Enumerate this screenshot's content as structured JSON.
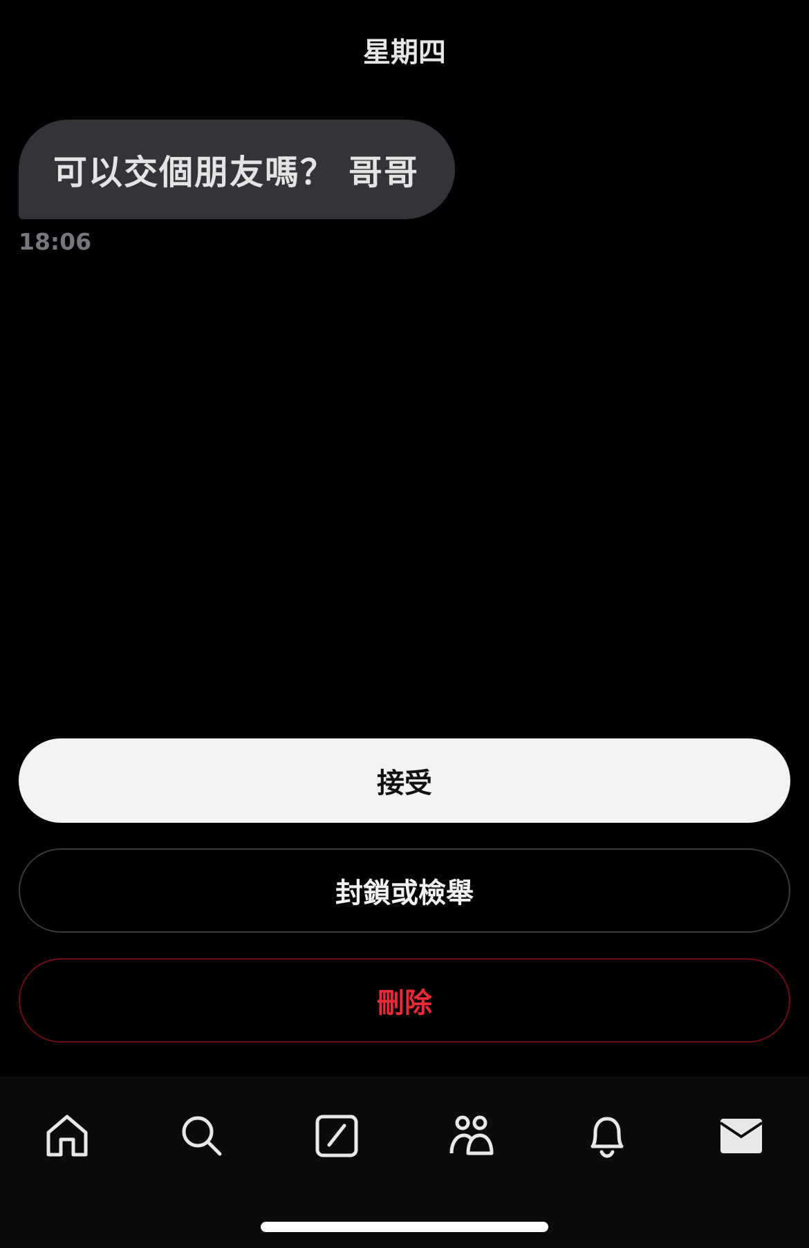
{
  "header": {
    "day_label": "星期四"
  },
  "message": {
    "text": "可以交個朋友嗎？ 哥哥",
    "time": "18:06"
  },
  "actions": {
    "accept_label": "接受",
    "block_or_report_label": "封鎖或檢舉",
    "delete_label": "刪除"
  },
  "colors": {
    "background": "#000000",
    "bubble": "#333438",
    "accept_button": "#f2f3f5",
    "delete_accent": "#ea2a36",
    "tab_bar": "#0b0b0b"
  },
  "tab_bar": {
    "items": [
      {
        "icon": "home-icon"
      },
      {
        "icon": "search-icon"
      },
      {
        "icon": "compose-icon"
      },
      {
        "icon": "people-icon"
      },
      {
        "icon": "bell-icon"
      },
      {
        "icon": "mail-icon",
        "active": true
      }
    ]
  }
}
